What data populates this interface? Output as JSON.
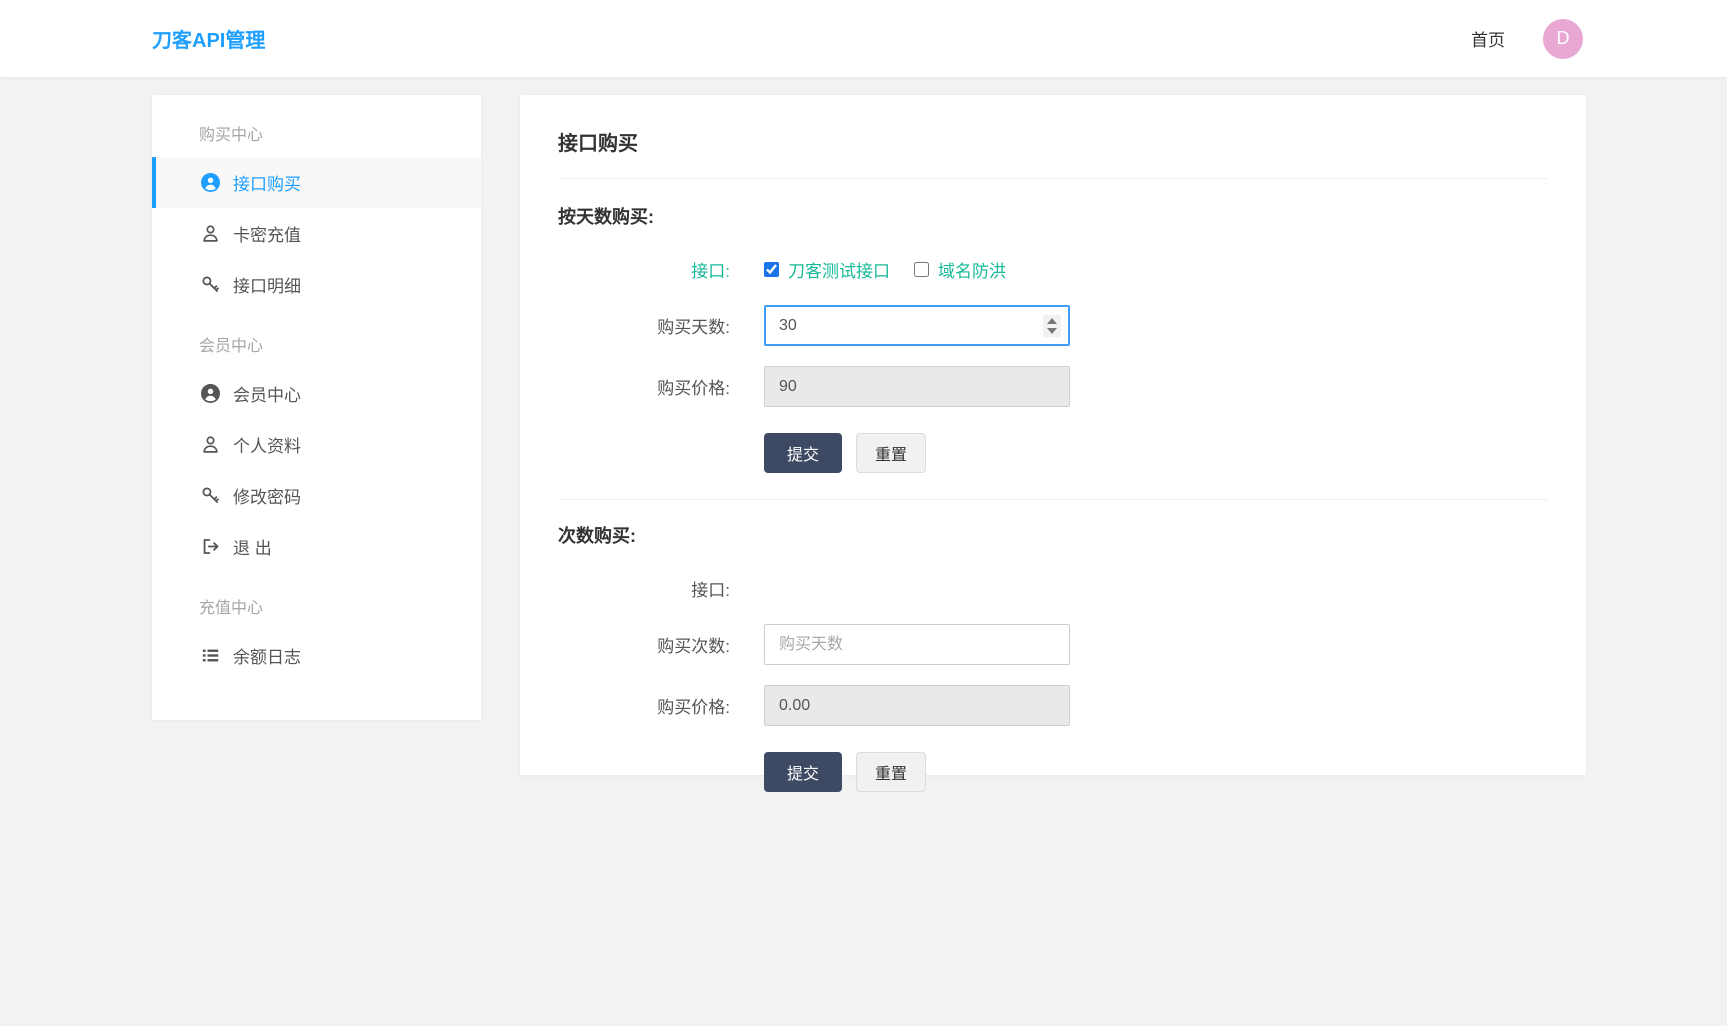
{
  "header": {
    "brand": "刀客API管理",
    "nav_home": "首页",
    "avatar_letter": "D"
  },
  "sidebar": {
    "groups": [
      {
        "label": "购买中心",
        "items": [
          {
            "label": "接口购买",
            "icon": "user-circle-icon",
            "active": true
          },
          {
            "label": "卡密充值",
            "icon": "user-icon",
            "active": false
          },
          {
            "label": "接口明细",
            "icon": "key-icon",
            "active": false
          }
        ]
      },
      {
        "label": "会员中心",
        "items": [
          {
            "label": "会员中心",
            "icon": "user-circle-icon",
            "active": false
          },
          {
            "label": "个人资料",
            "icon": "user-icon",
            "active": false
          },
          {
            "label": "修改密码",
            "icon": "key-icon",
            "active": false
          },
          {
            "label": "退 出",
            "icon": "sign-out-icon",
            "active": false
          }
        ]
      },
      {
        "label": "充值中心",
        "items": [
          {
            "label": "余额日志",
            "icon": "list-icon",
            "active": false
          }
        ]
      }
    ]
  },
  "main": {
    "title": "接口购买",
    "sections": [
      {
        "heading": "按天数购买:",
        "api_label": "接口:",
        "checkboxes": [
          {
            "label": "刀客测试接口",
            "checked": true
          },
          {
            "label": "域名防洪",
            "checked": false
          }
        ],
        "days_label": "购买天数:",
        "days_value": "30",
        "price_label": "购买价格:",
        "price_value": "90",
        "submit_label": "提交",
        "reset_label": "重置"
      },
      {
        "heading": "次数购买:",
        "api_label": "接口:",
        "times_label": "购买次数:",
        "times_placeholder": "购买天数",
        "price_label": "购买价格:",
        "price_value": "0.00",
        "submit_label": "提交",
        "reset_label": "重置"
      }
    ]
  },
  "colors": {
    "accent_blue": "#1e9fff",
    "teal_green": "#16b998",
    "dark_button": "#3e4a63",
    "avatar_pink": "#e9a7d4",
    "checkbox_checked": "#1a73e8",
    "body_background": "#f2f2f2"
  }
}
